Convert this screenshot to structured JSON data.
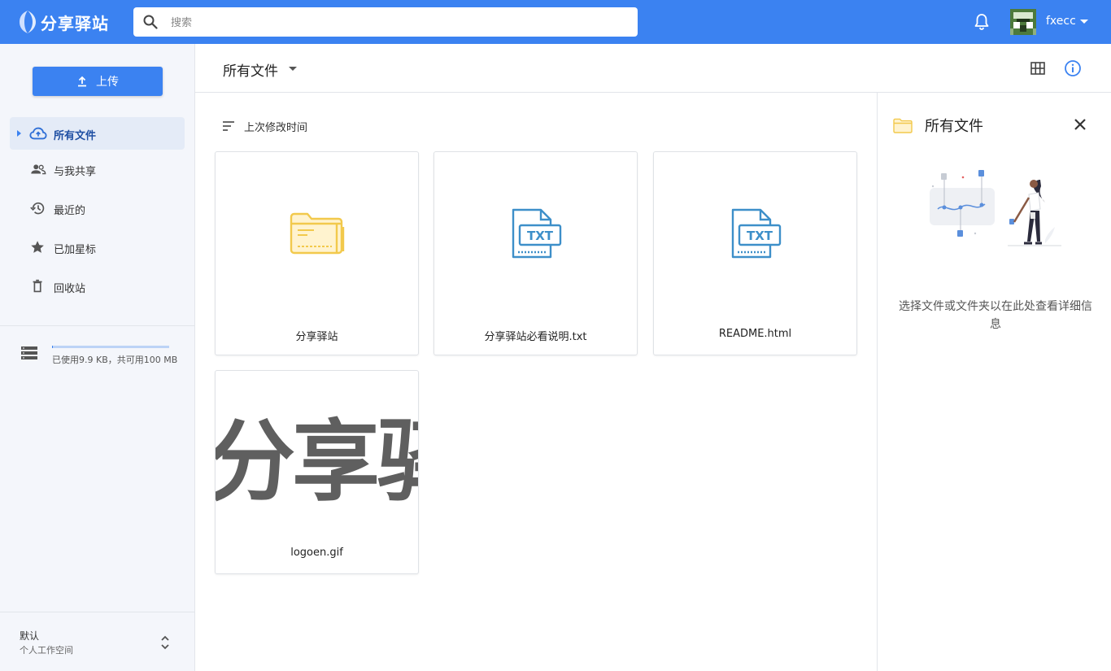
{
  "app": {
    "name": "分享驿站"
  },
  "search": {
    "placeholder": "搜索"
  },
  "user": {
    "name": "fxecc"
  },
  "sidebar": {
    "upload_label": "上传",
    "items": [
      {
        "label": "所有文件",
        "icon": "cloud-icon",
        "active": true
      },
      {
        "label": "与我共享",
        "icon": "people-icon"
      },
      {
        "label": "最近的",
        "icon": "history-icon"
      },
      {
        "label": "已加星标",
        "icon": "star-icon"
      },
      {
        "label": "回收站",
        "icon": "trash-icon"
      }
    ],
    "storage": {
      "text": "已使用9.9 KB，共可用100 MB",
      "used_fraction": 0.0001
    },
    "workspace": {
      "name": "默认",
      "subtitle": "个人工作空间"
    }
  },
  "toolbar": {
    "path": "所有文件"
  },
  "main": {
    "sort_label": "上次修改时间",
    "files": [
      {
        "name": "分享驿站",
        "type": "folder"
      },
      {
        "name": "分享驿站必看说明.txt",
        "type": "txt",
        "badge": "TXT"
      },
      {
        "name": "README.html",
        "type": "txt",
        "badge": "TXT"
      },
      {
        "name": "logoen.gif",
        "type": "image",
        "preview_text": "分享驿"
      }
    ]
  },
  "details": {
    "title": "所有文件",
    "hint": "选择文件或文件夹以在此处查看详细信息"
  },
  "colors": {
    "primary": "#3b82f1",
    "folder": "#f2c94c",
    "txt": "#3d8fc9"
  }
}
